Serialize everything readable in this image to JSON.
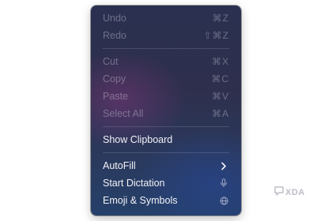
{
  "menu": {
    "items": [
      {
        "label": "Undo",
        "shortcut": "⌘Z",
        "enabled": false
      },
      {
        "label": "Redo",
        "shortcut": "⇧⌘Z",
        "enabled": false
      },
      {
        "label": "Cut",
        "shortcut": "⌘X",
        "enabled": false
      },
      {
        "label": "Copy",
        "shortcut": "⌘C",
        "enabled": false
      },
      {
        "label": "Paste",
        "shortcut": "⌘V",
        "enabled": false
      },
      {
        "label": "Select All",
        "shortcut": "⌘A",
        "enabled": false
      },
      {
        "label": "Show Clipboard",
        "enabled": true
      },
      {
        "label": "AutoFill",
        "enabled": true,
        "icon": "chevron-right-icon"
      },
      {
        "label": "Start Dictation",
        "enabled": true,
        "icon": "microphone-icon"
      },
      {
        "label": "Emoji & Symbols",
        "enabled": true,
        "icon": "globe-icon"
      }
    ]
  },
  "watermark": {
    "text": "XDA",
    "icon": "xda-logo-icon"
  },
  "colors": {
    "menu_background": "#2e3150",
    "enabled_text": "#f2f2f6",
    "disabled_text": "#7c7f95"
  }
}
